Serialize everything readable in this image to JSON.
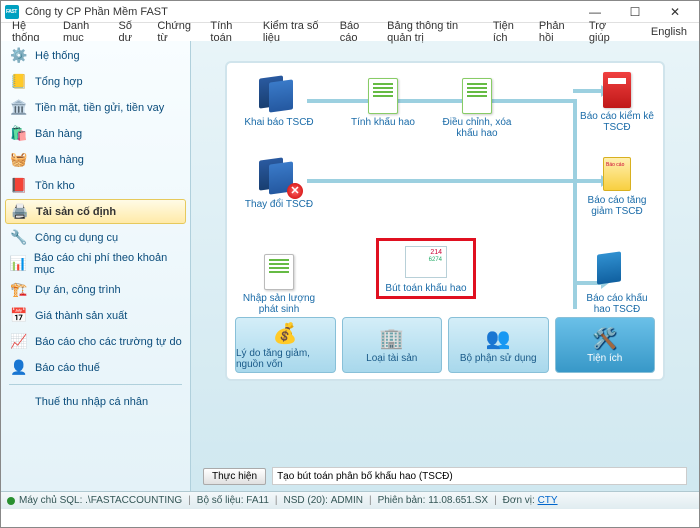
{
  "window": {
    "title": "Công ty CP Phần Mềm FAST"
  },
  "menu": [
    "Hệ thống",
    "Danh mục",
    "Số dư",
    "Chứng từ",
    "Tính toán",
    "Kiểm tra số liệu",
    "Báo cáo",
    "Bảng thông tin quản trị",
    "Tiện ích",
    "Phản hồi",
    "Trợ giúp"
  ],
  "menu_right": "English",
  "sidebar": {
    "items": [
      {
        "label": "Hệ thống",
        "icon": "⚙️"
      },
      {
        "label": "Tổng hợp",
        "icon": "📒"
      },
      {
        "label": "Tiền mặt, tiền gửi, tiền vay",
        "icon": "🏛️"
      },
      {
        "label": "Bán hàng",
        "icon": "🛍️"
      },
      {
        "label": "Mua hàng",
        "icon": "🧺"
      },
      {
        "label": "Tồn kho",
        "icon": "📕"
      },
      {
        "label": "Tài sản cố định",
        "icon": "🖨️",
        "active": true
      },
      {
        "label": "Công cụ dụng cụ",
        "icon": "🔧"
      },
      {
        "label": "Báo cáo chi phí theo khoản mục",
        "icon": "📊"
      },
      {
        "label": "Dự án, công trình",
        "icon": "🏗️"
      },
      {
        "label": "Giá thành sản xuất",
        "icon": "📅"
      },
      {
        "label": "Báo cáo cho các trường tự do",
        "icon": "📈"
      },
      {
        "label": "Báo cáo thuế",
        "icon": "👤"
      },
      {
        "label": "Thuế thu nhập cá nhân",
        "icon": "　"
      }
    ]
  },
  "flow": {
    "items": [
      {
        "id": "khaibao",
        "label": "Khai báo TSCĐ"
      },
      {
        "id": "tinhkh",
        "label": "Tính khấu hao"
      },
      {
        "id": "dieuchinh",
        "label": "Điều chỉnh, xóa khấu hao"
      },
      {
        "id": "bckk",
        "label": "Báo cáo kiểm kê TSCĐ"
      },
      {
        "id": "thaydoi",
        "label": "Thay đổi TSCĐ"
      },
      {
        "id": "bctg",
        "label": "Báo cáo tăng giảm TSCĐ"
      },
      {
        "id": "nhapsl",
        "label": "Nhập sản lượng phát sinh"
      },
      {
        "id": "buttoan",
        "label": "Bút toán khấu hao",
        "selected": true
      },
      {
        "id": "bckh",
        "label": "Báo cáo khấu hao TSCĐ"
      }
    ],
    "bottom": [
      {
        "label": "Lý do tăng giảm, nguồn vốn"
      },
      {
        "label": "Loại tài sản"
      },
      {
        "label": "Bộ phận sử dụng"
      },
      {
        "label": "Tiện ích",
        "hl": true
      }
    ]
  },
  "cmd": {
    "btn": "Thực hiện",
    "text": "Tạo bút toán phân bổ khấu hao (TSCĐ)"
  },
  "status": {
    "server_lbl": "Máy chủ SQL:",
    "server": ".\\FASTACCOUNTING",
    "bosolieu_lbl": "Bộ số liệu:",
    "bosolieu": "FA11",
    "nsd_lbl": "NSD (20):",
    "nsd": "ADMIN",
    "pb_lbl": "Phiên bản:",
    "pb": "11.08.651.SX",
    "dv_lbl": "Đơn vị:",
    "dv": "CTY"
  }
}
